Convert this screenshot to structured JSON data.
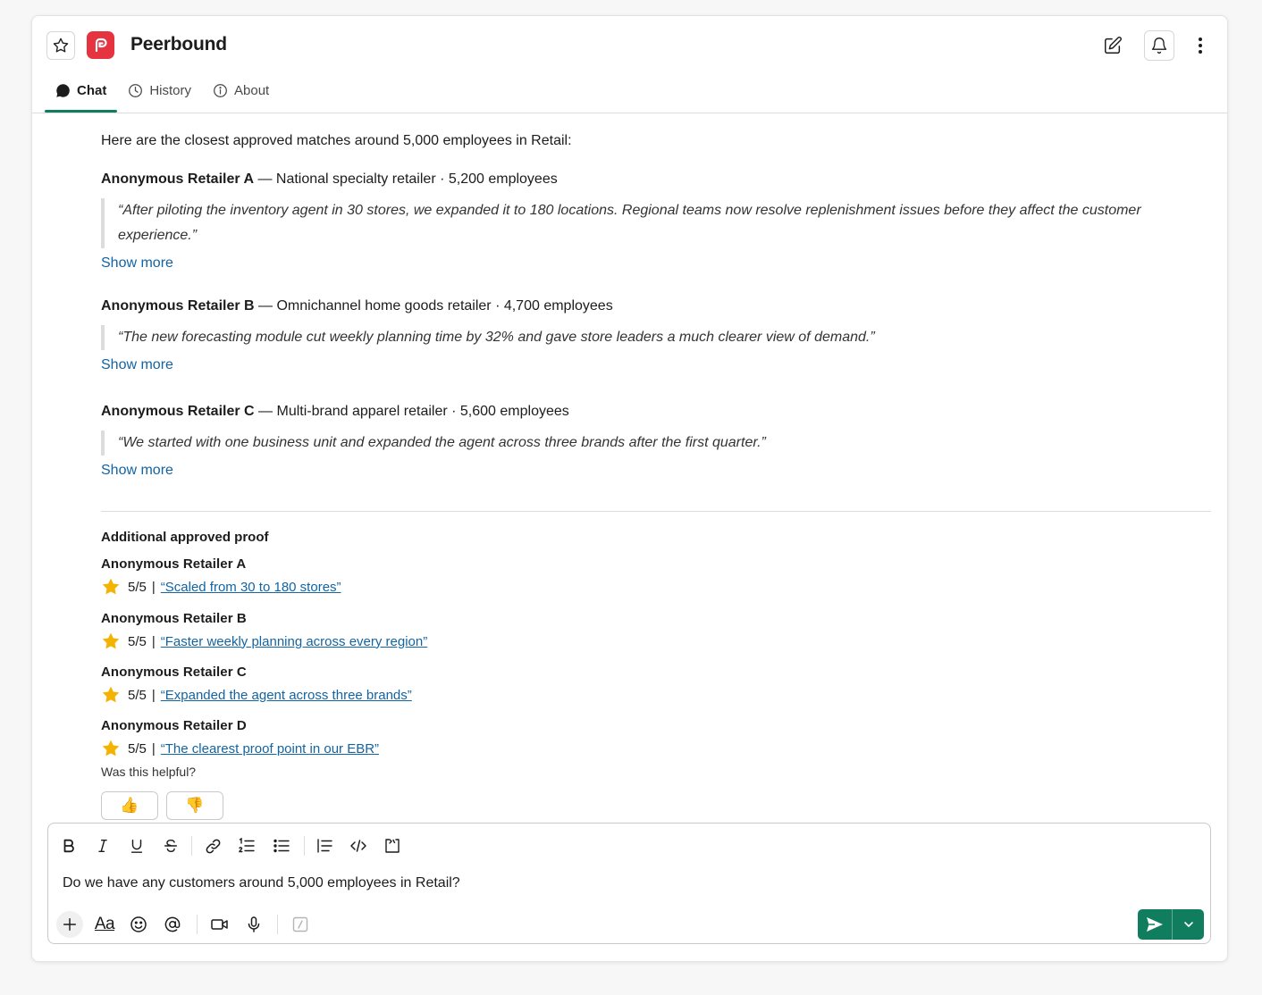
{
  "app": {
    "title": "Peerbound",
    "colors": {
      "brand": "#e5343f",
      "accent": "#117d5f",
      "link": "#1264a3"
    }
  },
  "tabs": [
    {
      "label": "Chat",
      "icon": "chat-bubble-icon",
      "active": true
    },
    {
      "label": "History",
      "icon": "clock-icon",
      "active": false
    },
    {
      "label": "About",
      "icon": "info-icon",
      "active": false
    }
  ],
  "message": {
    "intro": "Here are the closest approved matches around 5,000 employees in Retail:",
    "matches": [
      {
        "name": "Anonymous Retailer A",
        "details": " — National specialty retailer · 5,200 employees",
        "quote": "“After piloting the inventory agent in 30 stores, we expanded it to 180 locations. Regional teams now resolve replenishment issues before they affect the customer experience.”",
        "show_more": "Show more"
      },
      {
        "name": "Anonymous Retailer B",
        "details": " — Omnichannel home goods retailer · 4,700 employees",
        "quote": "“The new forecasting module cut weekly planning time by 32% and gave store leaders a much clearer view of demand.”",
        "show_more": "Show more"
      },
      {
        "name": "Anonymous Retailer C",
        "details": " — Multi-brand apparel retailer · 5,600 employees",
        "quote": "“We started with one business unit and expanded the agent across three brands after the first quarter.”",
        "show_more": "Show more"
      }
    ],
    "proof_heading": "Additional approved proof",
    "proofs": [
      {
        "name": "Anonymous Retailer A",
        "rating": "5/5",
        "link": "“Scaled from 30 to 180 stores”"
      },
      {
        "name": "Anonymous Retailer B",
        "rating": "5/5",
        "link": "“Faster weekly planning across every region”"
      },
      {
        "name": "Anonymous Retailer C",
        "rating": "5/5",
        "link": "“Expanded the agent across three brands”"
      },
      {
        "name": "Anonymous Retailer D",
        "rating": "5/5",
        "link": "“The clearest proof point in our EBR”"
      }
    ],
    "helpful_prompt": "Was this helpful?",
    "feedback": {
      "up": "👍",
      "down": "👎"
    }
  },
  "composer": {
    "text": "Do we have any customers around 5,000 employees in Retail?",
    "format_tools": [
      "bold-icon",
      "italic-icon",
      "underline-icon",
      "strikethrough-icon",
      "link-icon",
      "ordered-list-icon",
      "bulleted-list-icon",
      "blockquote-icon",
      "code-icon",
      "code-block-icon"
    ],
    "bottom_tools": [
      "plus-icon",
      "text-format-icon",
      "emoji-icon",
      "mention-icon",
      "video-icon",
      "microphone-icon",
      "slash-command-icon"
    ],
    "text_format_glyph": "Aa",
    "send": "send-icon"
  },
  "rating_separator": "|"
}
